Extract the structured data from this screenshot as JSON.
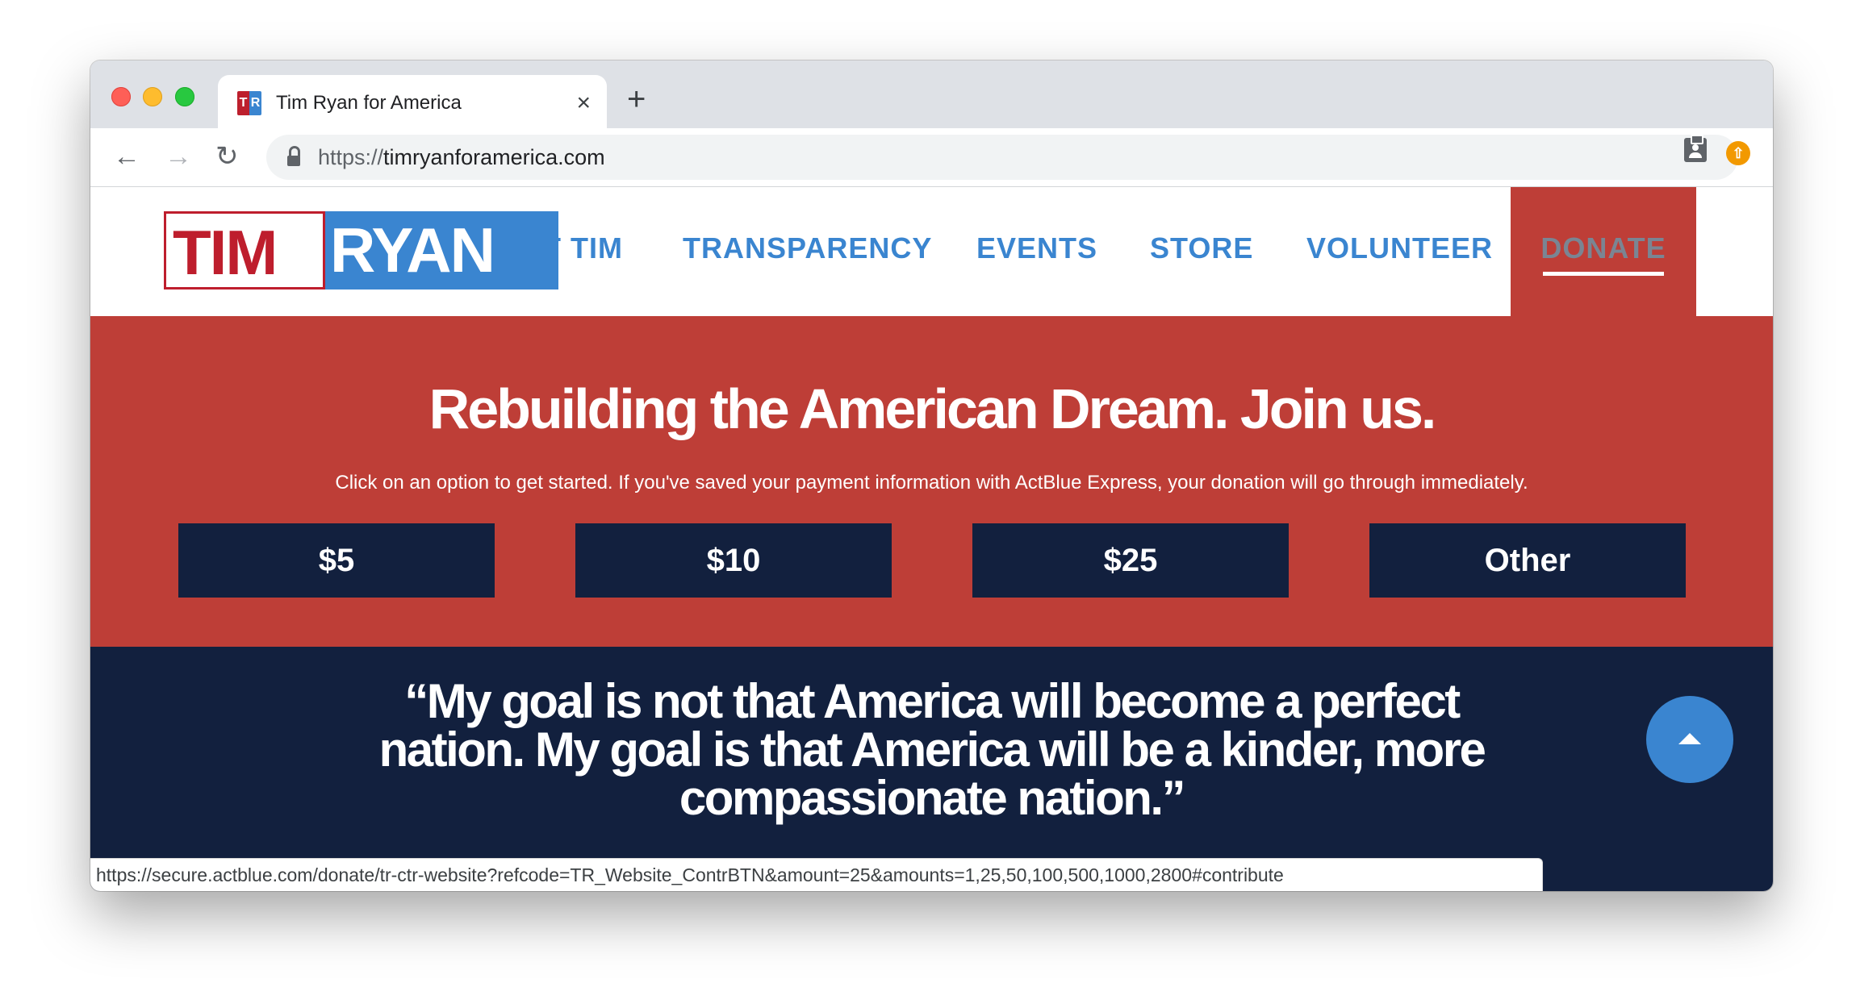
{
  "browser": {
    "tab_title": "Tim Ryan for America",
    "favicon_text": [
      "T",
      "R"
    ],
    "new_tab_symbol": "+",
    "close_symbol": "×",
    "url_scheme": "https://",
    "url_host": "timryanforamerica.com",
    "status_url": "https://secure.actblue.com/donate/tr-ctr-website?refcode=TR_Website_ContrBTN&amount=25&amounts=1,25,50,100,500,1000,2800#contribute"
  },
  "logo": {
    "first": "TIM",
    "last": "RYAN"
  },
  "nav": {
    "items": [
      "MEET TIM",
      "TRANSPARENCY",
      "EVENTS",
      "STORE",
      "VOLUNTEER"
    ],
    "donate": "DONATE"
  },
  "hero": {
    "headline": "Rebuilding the American Dream. Join us.",
    "subtext": "Click on an option to get started. If you've saved your payment information with ActBlue Express, your donation will go through immediately.",
    "amounts": [
      "$5",
      "$10",
      "$25",
      "Other"
    ]
  },
  "quote": {
    "text": "“My goal is not that America will become a perfect nation. My goal is that America will be a kinder, more compassionate nation.”"
  },
  "colors": {
    "brand_red": "#be3e37",
    "logo_red": "#be1e2d",
    "brand_blue": "#3a85d0",
    "navy": "#12203e"
  }
}
